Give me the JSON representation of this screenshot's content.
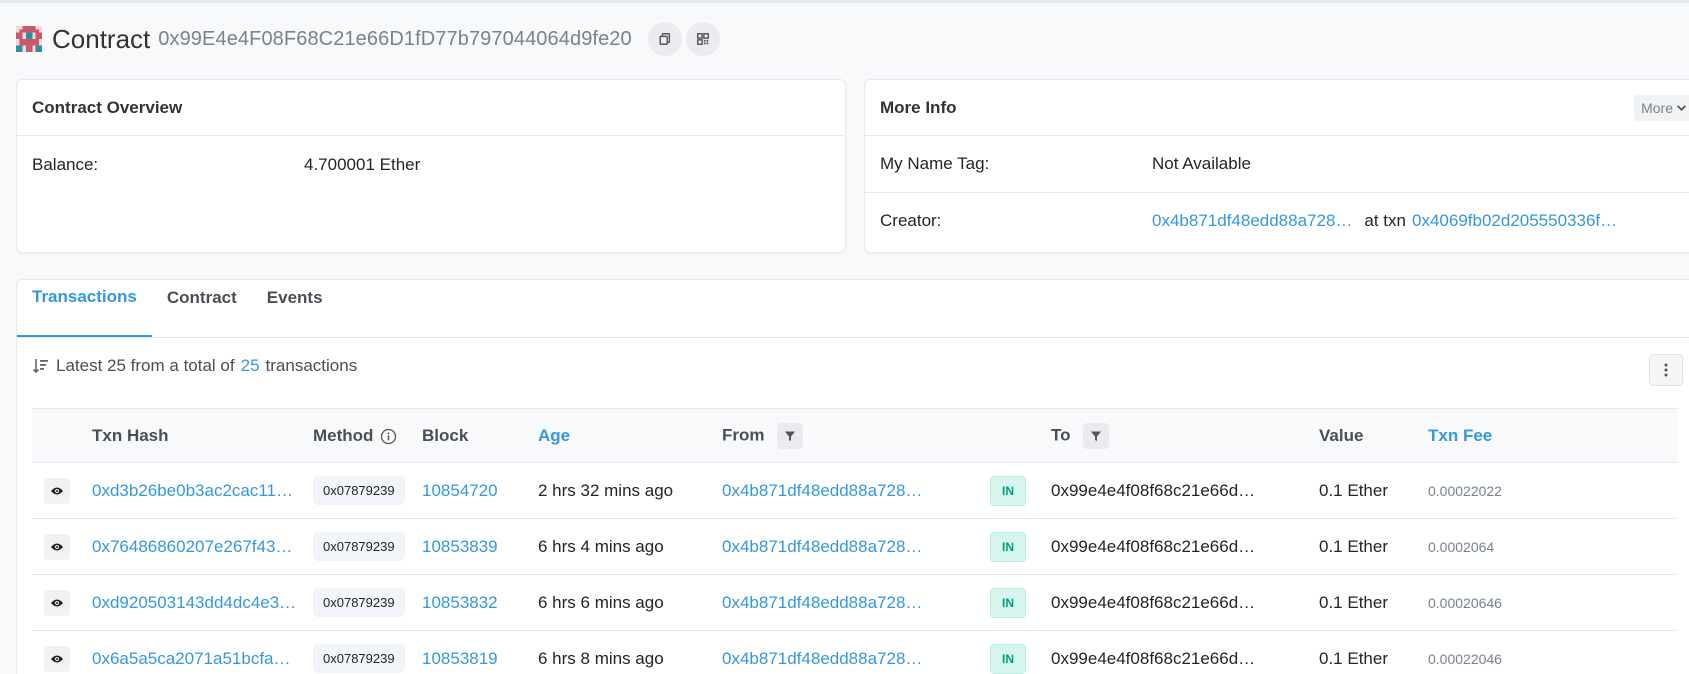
{
  "header": {
    "title": "Contract",
    "address": "0x99E4e4F08F68C21e66D1fD77b797044064d9fe20"
  },
  "overview": {
    "heading": "Contract Overview",
    "balance_label": "Balance:",
    "balance_value": "4.700001 Ether"
  },
  "more_info": {
    "heading": "More Info",
    "more_label": "More",
    "name_tag_label": "My Name Tag:",
    "name_tag_value": "Not Available",
    "creator_label": "Creator:",
    "creator_address": "0x4b871df48edd88a728…",
    "at_txn_label": "at txn",
    "creator_txn": "0x4069fb02d205550336f…"
  },
  "tabs": [
    {
      "label": "Transactions",
      "active": true
    },
    {
      "label": "Contract"
    },
    {
      "label": "Events"
    }
  ],
  "summary": {
    "prefix": "Latest 25 from a total of",
    "count": "25",
    "suffix": "transactions"
  },
  "table": {
    "headers": {
      "txn_hash": "Txn Hash",
      "method": "Method",
      "block": "Block",
      "age": "Age",
      "from": "From",
      "to": "To",
      "value": "Value",
      "txn_fee": "Txn Fee"
    },
    "rows": [
      {
        "hash": "0xd3b26be0b3ac2cac11…",
        "method": "0x07879239",
        "block": "10854720",
        "age": "2 hrs 32 mins ago",
        "from": "0x4b871df48edd88a728…",
        "direction": "IN",
        "to": "0x99e4e4f08f68c21e66d…",
        "value": "0.1 Ether",
        "fee": "0.00022022"
      },
      {
        "hash": "0x76486860207e267f43…",
        "method": "0x07879239",
        "block": "10853839",
        "age": "6 hrs 4 mins ago",
        "from": "0x4b871df48edd88a728…",
        "direction": "IN",
        "to": "0x99e4e4f08f68c21e66d…",
        "value": "0.1 Ether",
        "fee": "0.0002064"
      },
      {
        "hash": "0xd920503143dd4dc4e3…",
        "method": "0x07879239",
        "block": "10853832",
        "age": "6 hrs 6 mins ago",
        "from": "0x4b871df48edd88a728…",
        "direction": "IN",
        "to": "0x99e4e4f08f68c21e66d…",
        "value": "0.1 Ether",
        "fee": "0.00020646"
      },
      {
        "hash": "0x6a5a5ca2071a51bcfa…",
        "method": "0x07879239",
        "block": "10853819",
        "age": "6 hrs 8 mins ago",
        "from": "0x4b871df48edd88a728…",
        "direction": "IN",
        "to": "0x99e4e4f08f68c21e66d…",
        "value": "0.1 Ether",
        "fee": "0.00022046"
      }
    ]
  },
  "colors": {
    "link": "#3498db",
    "in_badge_bg": "#d6f5ee",
    "in_badge_text": "#00a186",
    "muted": "#77838f"
  },
  "icons": {
    "identicon": "contract-identicon",
    "copy": "copy-icon",
    "qr": "qr-code-icon",
    "sort": "sort-desc-icon",
    "kebab": "vertical-ellipsis-icon",
    "eye": "eye-icon",
    "info": "info-circle-icon",
    "filter": "filter-icon",
    "chevron": "chevron-down-icon"
  }
}
